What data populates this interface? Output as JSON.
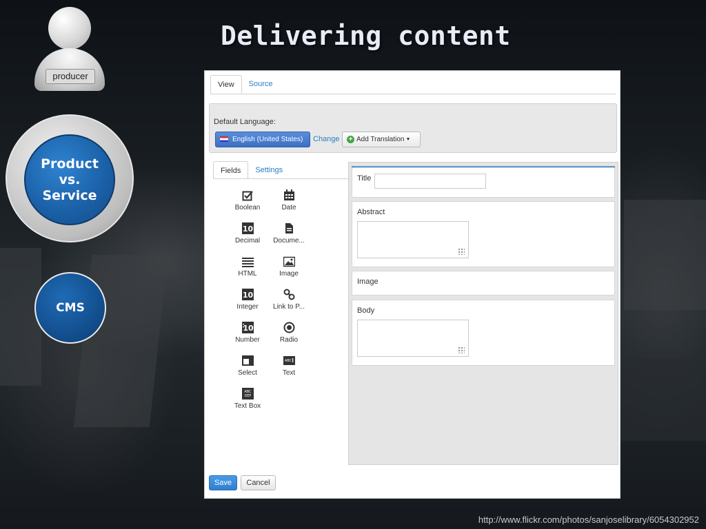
{
  "slide": {
    "title": "Delivering content",
    "producer_label": "producer",
    "circle_product_service": "Product\nvs.\nService",
    "circle_cms": "CMS",
    "credit": "http://www.flickr.com/photos/sanjoselibrary/6054302952"
  },
  "cms": {
    "tabs": [
      "View",
      "Source"
    ],
    "default_language_label": "Default Language:",
    "language_button": "English (United States)",
    "change_link": "Change",
    "add_translation": "Add Translation",
    "side_tabs": [
      "Fields",
      "Settings"
    ],
    "fields": [
      {
        "label": "Boolean",
        "icon": "checkbox-icon"
      },
      {
        "label": "Date",
        "icon": "calendar-icon"
      },
      {
        "label": "Decimal",
        "icon": "decimal-icon"
      },
      {
        "label": "Docume...",
        "icon": "document-icon"
      },
      {
        "label": "HTML",
        "icon": "html-icon"
      },
      {
        "label": "Image",
        "icon": "image-icon"
      },
      {
        "label": "Integer",
        "icon": "integer-icon"
      },
      {
        "label": "Link to P...",
        "icon": "link-icon"
      },
      {
        "label": "Number",
        "icon": "number-icon"
      },
      {
        "label": "Radio",
        "icon": "radio-icon"
      },
      {
        "label": "Select",
        "icon": "select-icon"
      },
      {
        "label": "Text",
        "icon": "text-icon"
      },
      {
        "label": "Text Box",
        "icon": "textbox-icon"
      }
    ],
    "form_fields": {
      "title": "Title",
      "abstract": "Abstract",
      "image": "Image",
      "body": "Body"
    },
    "save_label": "Save",
    "cancel_label": "Cancel",
    "accent_color": "#3d6fc4"
  }
}
